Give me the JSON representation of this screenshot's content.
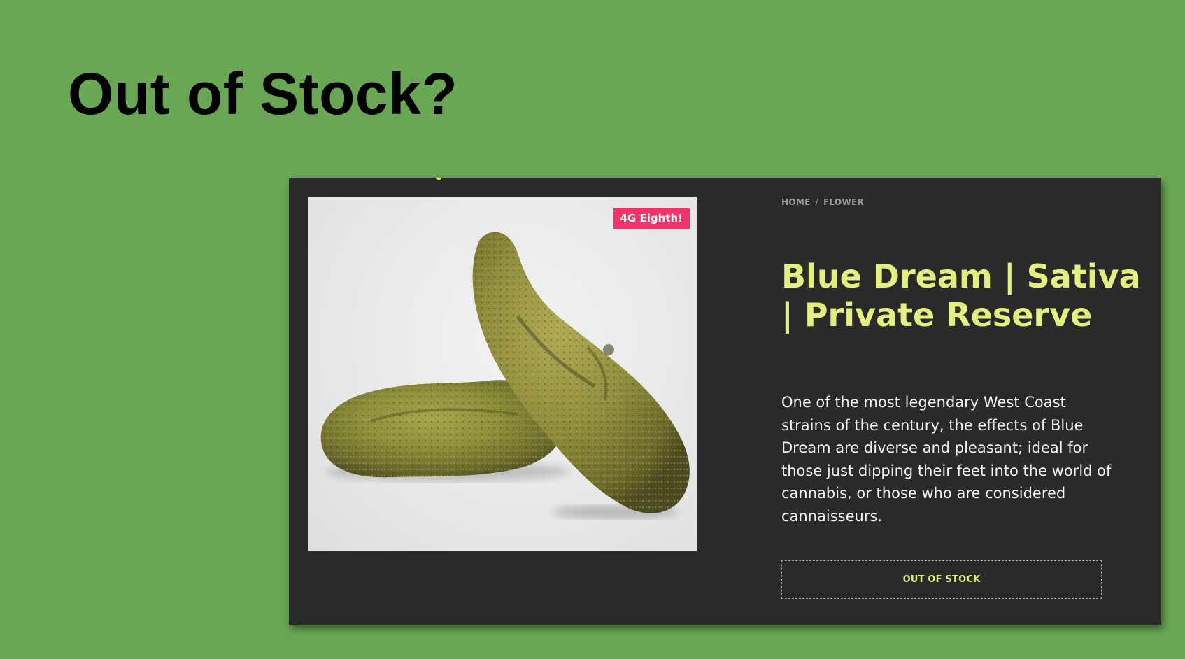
{
  "slide": {
    "title": "Out of Stock?",
    "background_color": "#6aa755"
  },
  "product_page": {
    "background_color": "#2a2a2a",
    "image": {
      "alt": "cannabis-buds-image",
      "badge": "4G Eighth!",
      "badge_color": "#f0336b"
    },
    "breadcrumb": {
      "items": [
        "HOME",
        "FLOWER"
      ],
      "separator": "/"
    },
    "title": "Blue Dream | Sativa | Private Reserve",
    "title_color": "#e3f07f",
    "description": "One of the most legendary West Coast strains of the century, the effects of Blue Dream are diverse and pleasant; ideal for those just dipping their feet into the world of cannabis, or those who are considered cannaisseurs.",
    "stock_button": "OUT OF STOCK"
  }
}
